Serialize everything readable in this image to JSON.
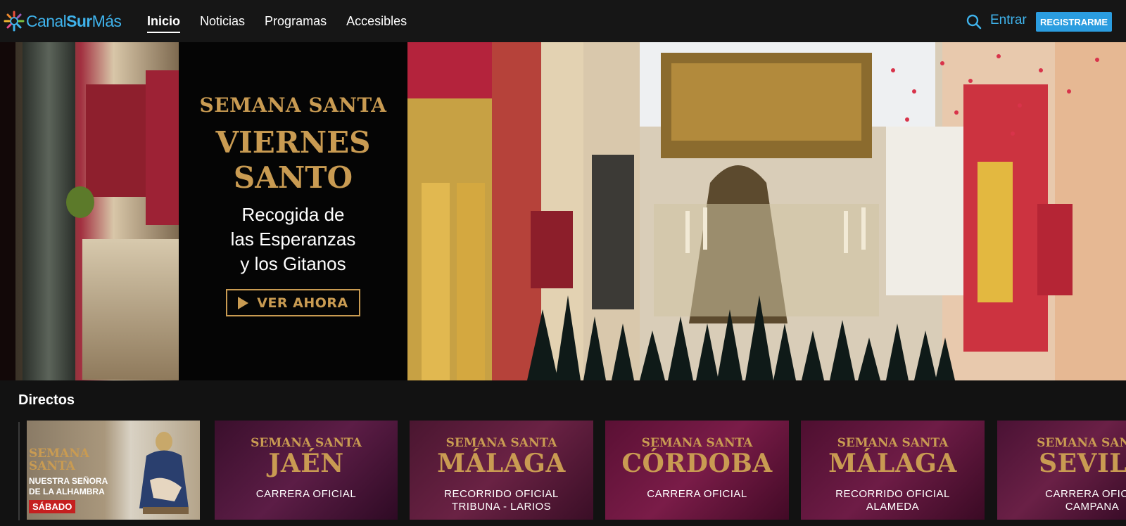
{
  "brand": {
    "name_part1": "Canal",
    "name_part2": "Sur",
    "name_part3": "Más"
  },
  "nav": {
    "items": [
      {
        "label": "Inicio",
        "active": true
      },
      {
        "label": "Noticias",
        "active": false
      },
      {
        "label": "Programas",
        "active": false
      },
      {
        "label": "Accesibles",
        "active": false
      }
    ],
    "login_label": "Entrar",
    "register_label": "REGISTRARME"
  },
  "hero": {
    "kicker": "SEMANA SANTA",
    "title": "VIERNES\nSANTO",
    "subtitle": "Recogida de\nlas Esperanzas\ny los Gitanos",
    "cta_label": "VER AHORA"
  },
  "directos": {
    "section_title": "Directos",
    "cards": [
      {
        "kicker": "SEMANA\nSANTA",
        "line": "NUESTRA SEÑORA\nDE LA ALHAMBRA",
        "badge": "SÁBADO"
      },
      {
        "kicker": "SEMANA SANTA",
        "city": "JAÉN",
        "route": "CARRERA OFICIAL"
      },
      {
        "kicker": "SEMANA SANTA",
        "city": "MÁLAGA",
        "route": "RECORRIDO OFICIAL\nTRIBUNA - LARIOS"
      },
      {
        "kicker": "SEMANA SANTA",
        "city": "CÓRDOBA",
        "route": "CARRERA OFICIAL"
      },
      {
        "kicker": "SEMANA SANTA",
        "city": "MÁLAGA",
        "route": "RECORRIDO OFICIAL\nALAMEDA"
      },
      {
        "kicker": "SEMANA SANTA",
        "city": "SEVILL",
        "route": "CARRERA OFICIA\nCAMPANA"
      }
    ]
  },
  "colors": {
    "accent_blue": "#3fb3ec",
    "register_blue": "#2b9de0",
    "gold": "#c99b52",
    "badge_red": "#c51f1f",
    "background": "#121212"
  },
  "icons": {
    "search": "search-icon",
    "play": "play-icon",
    "logo": "canalsur-star-icon"
  }
}
